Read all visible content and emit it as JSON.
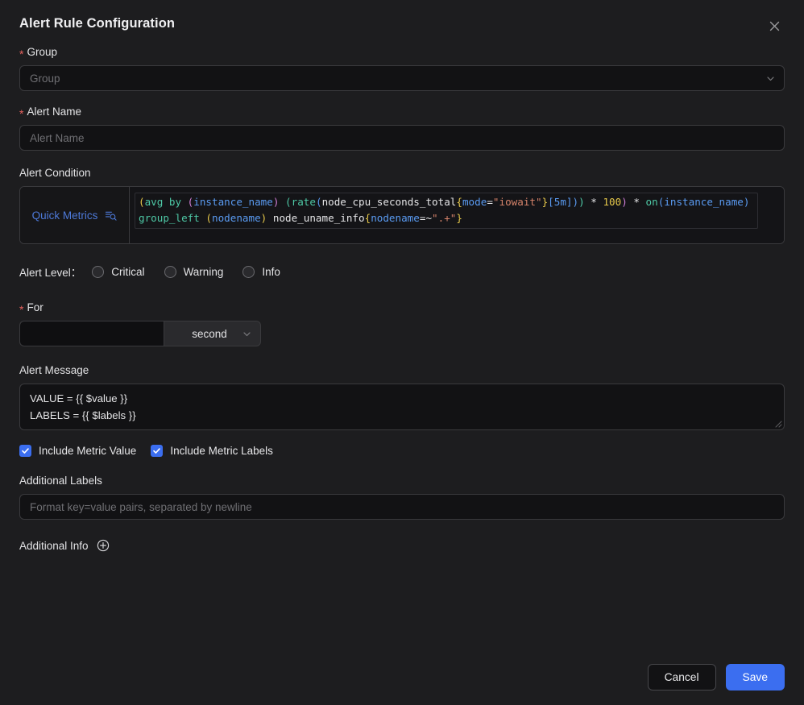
{
  "dialog": {
    "title": "Alert Rule Configuration",
    "close_icon": "close-icon"
  },
  "group": {
    "label": "Group",
    "required_mark": "*",
    "placeholder": "Group",
    "value": "",
    "chevron_icon": "chevron-down-icon"
  },
  "alert_name": {
    "label": "Alert Name",
    "required_mark": "*",
    "placeholder": "Alert Name",
    "value": ""
  },
  "alert_condition": {
    "label": "Alert Condition",
    "quick_metrics_label": "Quick Metrics",
    "quick_metrics_icon": "list-search-icon",
    "query": "(avg by (instance_name) (rate(node_cpu_seconds_total{mode=\"iowait\"}[5m])) * 100) * on(instance_name) group_left (nodename) node_uname_info{nodename=~\".+\"}",
    "query_tokens_line1": [
      {
        "t": "(",
        "c": "yellow"
      },
      {
        "t": "avg by ",
        "c": "green"
      },
      {
        "t": "(",
        "c": "purple"
      },
      {
        "t": "instance_name",
        "c": "blue"
      },
      {
        "t": ")",
        "c": "purple"
      },
      {
        "t": " ",
        "c": "white"
      },
      {
        "t": "(",
        "c": "green"
      },
      {
        "t": "rate",
        "c": "green"
      },
      {
        "t": "(",
        "c": "blue"
      },
      {
        "t": "node_cpu_seconds_total",
        "c": "white"
      },
      {
        "t": "{",
        "c": "yellow"
      },
      {
        "t": "mode",
        "c": "blue"
      },
      {
        "t": "=",
        "c": "white"
      },
      {
        "t": "\"iowait\"",
        "c": "orange"
      },
      {
        "t": "}",
        "c": "yellow"
      },
      {
        "t": "[5m]",
        "c": "blue"
      },
      {
        "t": ")",
        "c": "blue"
      },
      {
        "t": ")",
        "c": "green"
      },
      {
        "t": " * ",
        "c": "white"
      },
      {
        "t": "100",
        "c": "yellow"
      },
      {
        "t": ")",
        "c": "purple"
      },
      {
        "t": " * ",
        "c": "white"
      },
      {
        "t": "on",
        "c": "green"
      },
      {
        "t": "(",
        "c": "blue"
      },
      {
        "t": "instance_name",
        "c": "blue"
      },
      {
        "t": ")",
        "c": "blue"
      }
    ],
    "query_tokens_line2": [
      {
        "t": "group_left ",
        "c": "green"
      },
      {
        "t": "(",
        "c": "yellow"
      },
      {
        "t": "nodename",
        "c": "blue"
      },
      {
        "t": ")",
        "c": "yellow"
      },
      {
        "t": " ",
        "c": "white"
      },
      {
        "t": "node_uname_info",
        "c": "white"
      },
      {
        "t": "{",
        "c": "yellow"
      },
      {
        "t": "nodename",
        "c": "blue"
      },
      {
        "t": "=~",
        "c": "white"
      },
      {
        "t": "\".+\"",
        "c": "orange"
      },
      {
        "t": "}",
        "c": "yellow"
      }
    ]
  },
  "alert_level": {
    "label": "Alert Level：",
    "options": [
      {
        "label": "Critical",
        "selected": false
      },
      {
        "label": "Warning",
        "selected": false
      },
      {
        "label": "Info",
        "selected": false
      }
    ]
  },
  "for_field": {
    "label": "For",
    "required_mark": "*",
    "value": "",
    "unit": "second",
    "chevron_icon": "chevron-down-icon"
  },
  "alert_message": {
    "label": "Alert Message",
    "lines": [
      "VALUE = {{ $value }}",
      "LABELS = {{ $labels }}"
    ],
    "resize_icon": "resize-grip-icon"
  },
  "checkboxes": [
    {
      "label": "Include Metric Value",
      "checked": true
    },
    {
      "label": "Include Metric Labels",
      "checked": true
    }
  ],
  "additional_labels": {
    "label": "Additional Labels",
    "placeholder": "Format key=value pairs, separated by newline",
    "value": ""
  },
  "additional_info": {
    "label": "Additional Info",
    "add_icon": "plus-circle-icon"
  },
  "footer": {
    "cancel_label": "Cancel",
    "save_label": "Save"
  },
  "colors": {
    "accent": "#3b6ef0",
    "required": "#e8635f",
    "link": "#4d79d8",
    "background": "#1d1d1f"
  }
}
